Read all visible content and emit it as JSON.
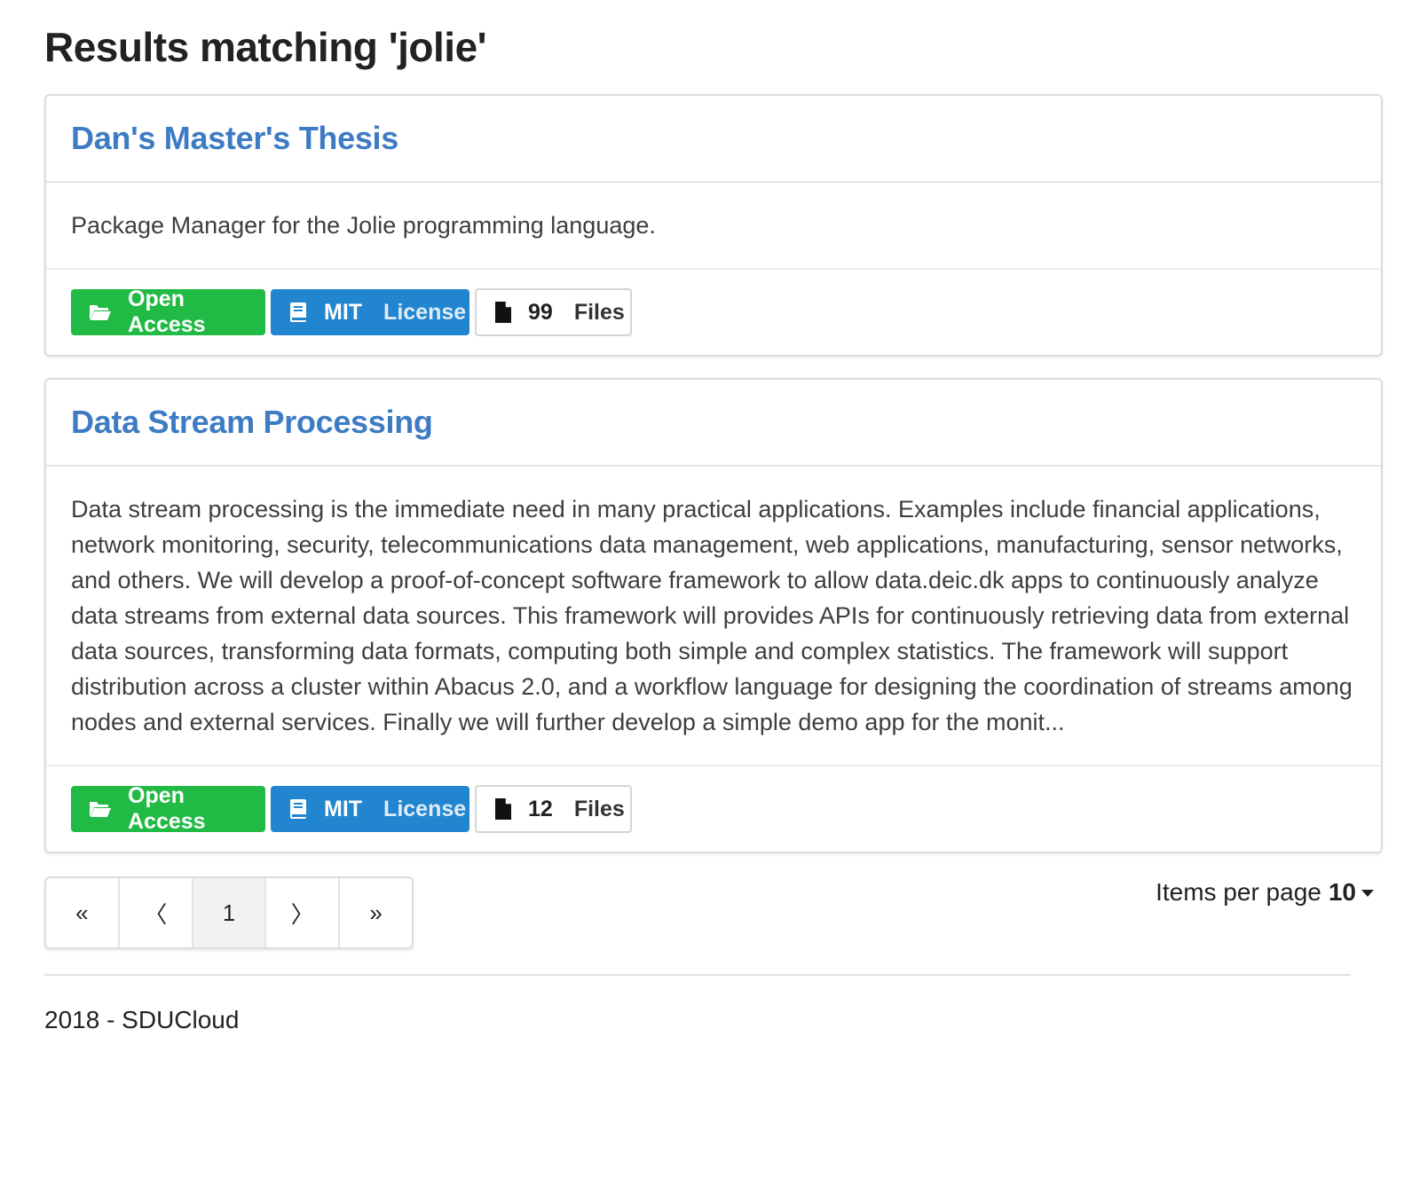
{
  "page": {
    "title": "Results matching 'jolie'"
  },
  "results": [
    {
      "title": "Dan's Master's Thesis",
      "description": "Package Manager for the Jolie programming language.",
      "access_label": "Open Access",
      "license_name": "MIT",
      "license_label": "License",
      "file_count": "99",
      "files_label": "Files"
    },
    {
      "title": "Data Stream Processing",
      "description": "Data stream processing is the immediate need in many practical applications. Examples include financial applications, network monitoring, security, telecommunications data management, web applications, manufacturing, sensor networks, and others. We will develop a proof-of-concept software framework to allow data.deic.dk apps to continuously analyze data streams from external data sources. This framework will provides APIs for continuously retrieving data from external data sources, transforming data formats, computing both simple and complex statistics. The framework will support distribution across a cluster within Abacus 2.0, and a workflow language for designing the coordination of streams among nodes and external services. Finally we will further develop a simple demo app for the monit...",
      "access_label": "Open Access",
      "license_name": "MIT",
      "license_label": "License",
      "file_count": "12",
      "files_label": "Files"
    }
  ],
  "pagination": {
    "first": "«",
    "prev": "〈",
    "current": "1",
    "next": "〉",
    "last": "»"
  },
  "items_per_page": {
    "label": "Items per page",
    "value": "10"
  },
  "footer": {
    "text": "2018 - SDUCloud"
  },
  "colors": {
    "title_link": "#3d7bc4",
    "open_access": "#21ba45",
    "license": "#2185d0"
  },
  "icons": {
    "open_access": "folder-open-icon",
    "license": "book-icon",
    "files": "file-icon",
    "per_page": "caret-down-icon"
  }
}
